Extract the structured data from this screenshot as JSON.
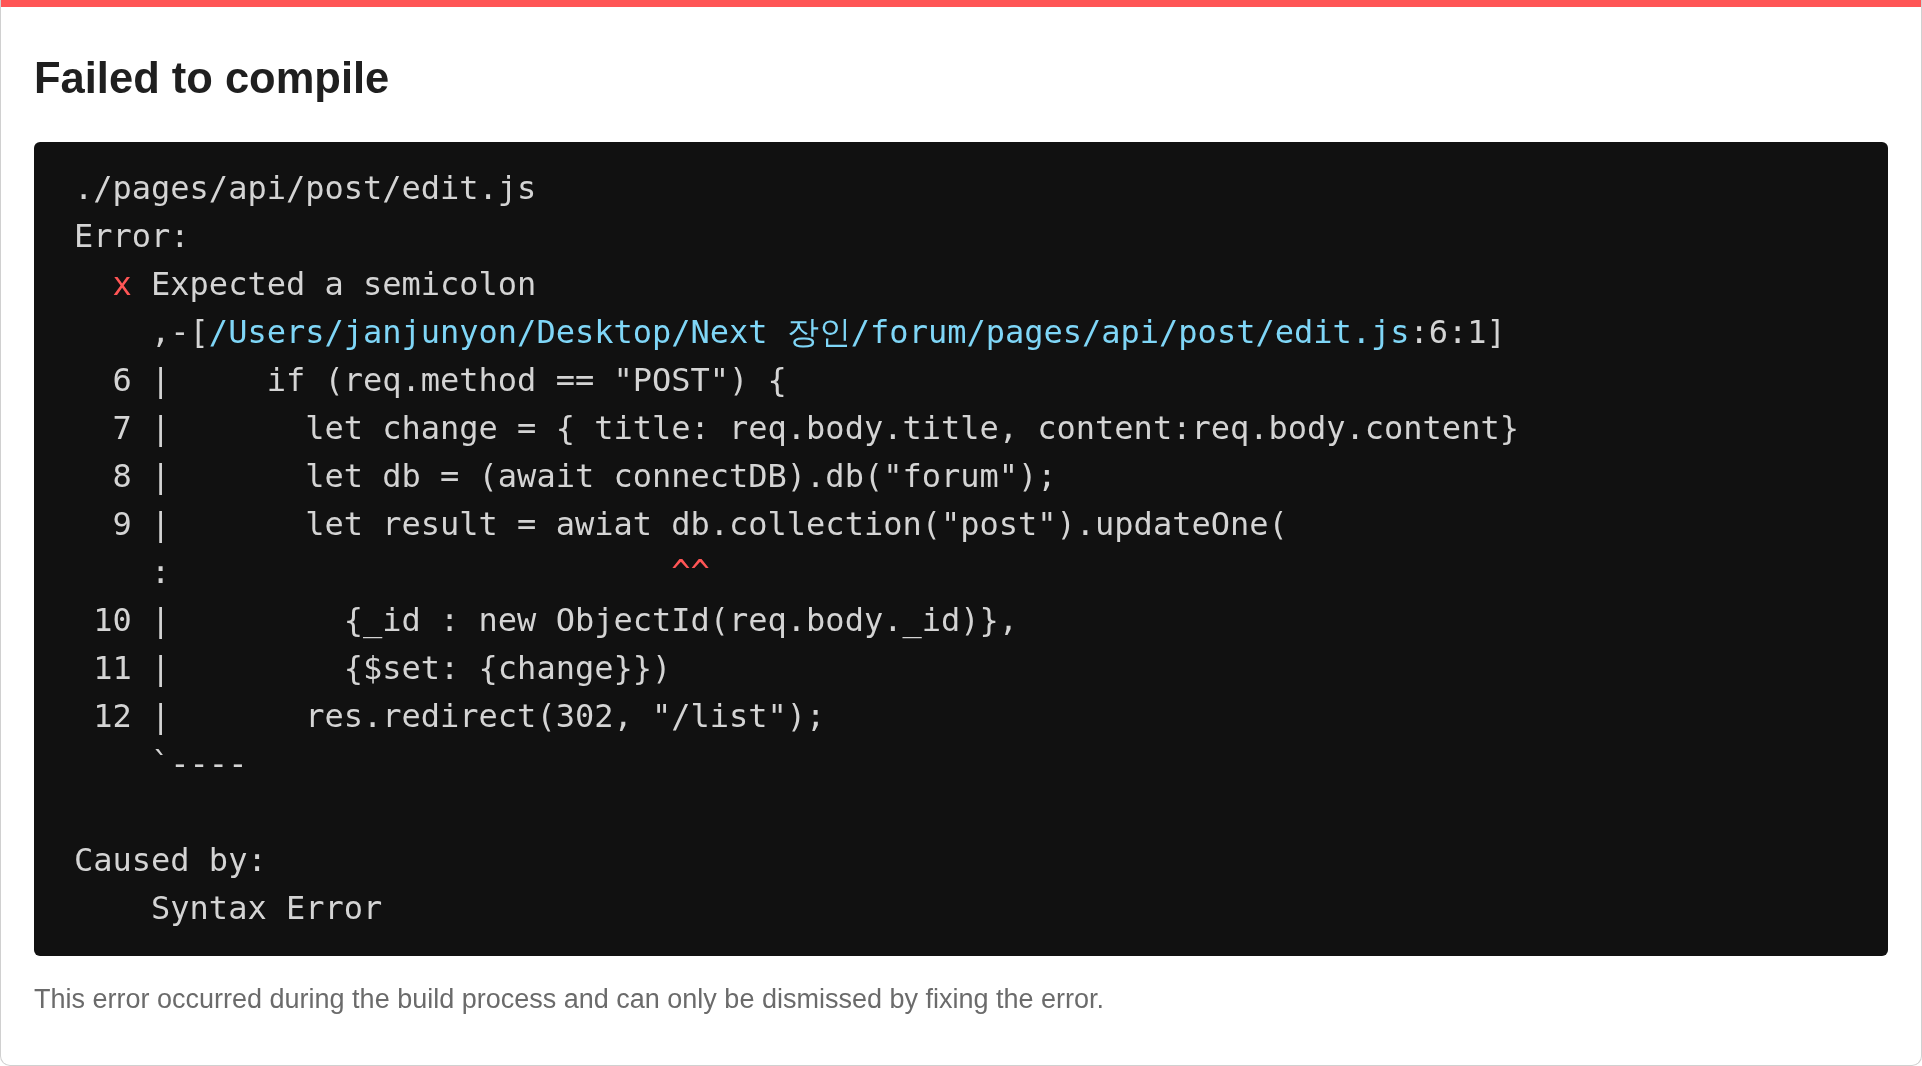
{
  "title": "Failed to compile",
  "code_lines": [
    {
      "segments": [
        {
          "kind": "plain",
          "text": "./pages/api/post/edit.js"
        }
      ]
    },
    {
      "segments": [
        {
          "kind": "plain",
          "text": "Error:"
        }
      ]
    },
    {
      "kind": "message",
      "segments": [
        {
          "kind": "error",
          "text": "x"
        },
        {
          "kind": "plain",
          "text": " Expected a semicolon"
        }
      ]
    },
    {
      "segments": [
        {
          "kind": "plain",
          "text": "    ,-["
        },
        {
          "kind": "link",
          "text": "/Users/janjunyon/Desktop/Next 장인/forum/pages/api/post/edit.js"
        },
        {
          "kind": "plain",
          "text": ":6:1]"
        }
      ]
    },
    {
      "segments": [
        {
          "kind": "plain",
          "text": "  6 |     if (req.method == \"POST\") {"
        }
      ]
    },
    {
      "segments": [
        {
          "kind": "plain",
          "text": "  7 |       let change = { title: req.body.title, content:req.body.content}"
        }
      ]
    },
    {
      "segments": [
        {
          "kind": "plain",
          "text": "  8 |       let db = (await connectDB).db(\"forum\");"
        }
      ]
    },
    {
      "segments": [
        {
          "kind": "plain",
          "text": "  9 |       let result = awiat db.collection(\"post\").updateOne("
        }
      ]
    },
    {
      "segments": [
        {
          "kind": "plain",
          "text": "    :                          "
        },
        {
          "kind": "error",
          "text": "^^"
        }
      ]
    },
    {
      "segments": [
        {
          "kind": "plain",
          "text": " 10 |         {_id : new ObjectId(req.body._id)},"
        }
      ]
    },
    {
      "segments": [
        {
          "kind": "plain",
          "text": " 11 |         {$set: {change}})"
        }
      ]
    },
    {
      "segments": [
        {
          "kind": "plain",
          "text": " 12 |       res.redirect(302, \"/list\");"
        }
      ]
    },
    {
      "segments": [
        {
          "kind": "plain",
          "text": "    `----"
        }
      ]
    },
    {
      "kind": "blank"
    },
    {
      "segments": [
        {
          "kind": "plain",
          "text": "Caused by:"
        }
      ]
    },
    {
      "segments": [
        {
          "kind": "plain",
          "text": "    Syntax Error"
        }
      ]
    }
  ],
  "footer": "This error occurred during the build process and can only be dismissed by fixing the error."
}
